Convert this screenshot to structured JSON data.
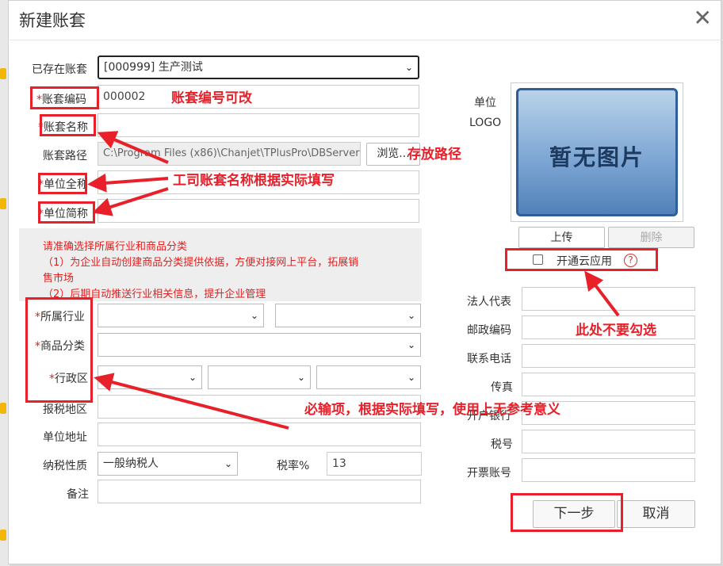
{
  "dialog": {
    "title": "新建账套",
    "close_glyph": "✕"
  },
  "form": {
    "existing": {
      "label": "已存在账套",
      "value": "[000999] 生产测试"
    },
    "code": {
      "label": "账套编码",
      "value": "000002"
    },
    "name": {
      "label": "账套名称"
    },
    "path": {
      "label": "账套路径",
      "value": "C:\\Program Files (x86)\\Chanjet\\TPlusPro\\DBServer",
      "browse": "浏览..."
    },
    "fullname": {
      "label": "单位全称"
    },
    "shortname": {
      "label": "单位简称"
    },
    "notice": {
      "line1": "请准确选择所属行业和商品分类",
      "line2": "（1）为企业自动创建商品分类提供依据，方便对接网上平台，拓展销",
      "line3": "售市场",
      "line4": "（2）后期自动推送行业相关信息，提升企业管理"
    },
    "industry": {
      "label": "所属行业"
    },
    "category": {
      "label": "商品分类"
    },
    "region": {
      "label": "行政区"
    },
    "tax_region": {
      "label": "报税地区"
    },
    "address": {
      "label": "单位地址"
    },
    "tax_type": {
      "label": "纳税性质",
      "value": "一般纳税人"
    },
    "tax_rate": {
      "label": "税率%",
      "value": "13"
    },
    "remark": {
      "label": "备注"
    }
  },
  "logo": {
    "label_line1": "单位",
    "label_line2": "LOGO",
    "placeholder": "暂无图片",
    "upload": "上传",
    "delete": "删除",
    "cloud_label": "开通云应用",
    "help": "?"
  },
  "right": {
    "legal": "法人代表",
    "postal": "邮政编码",
    "phone": "联系电话",
    "fax": "传真",
    "bank": "开户银行",
    "taxno": "税号",
    "account": "开票账号"
  },
  "buttons": {
    "next": "下一步",
    "cancel": "取消"
  },
  "annotations": {
    "code_editable": "账套编号可改",
    "save_path": "存放路径",
    "name_note": "工司账套名称根据实际填写",
    "no_check": "此处不要勾选",
    "required_note": "必输项，根据实际填写，使用上无参考意义"
  },
  "colors": {
    "annotation_red": "#e8202a",
    "required_red": "#e02020"
  }
}
